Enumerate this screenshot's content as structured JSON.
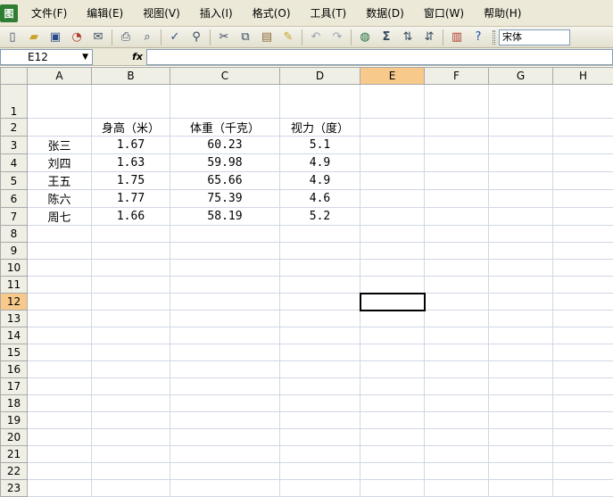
{
  "menu": {
    "app_icon": "图",
    "items": [
      "文件(F)",
      "编辑(E)",
      "视图(V)",
      "插入(I)",
      "格式(O)",
      "工具(T)",
      "数据(D)",
      "窗口(W)",
      "帮助(H)"
    ]
  },
  "toolbar": {
    "font_name": "宋体"
  },
  "formula": {
    "cell_ref": "E12",
    "fx": "fx",
    "content": ""
  },
  "columns": [
    "A",
    "B",
    "C",
    "D",
    "E",
    "F",
    "G",
    "H"
  ],
  "active_column": "E",
  "active_row": 12,
  "header_row": [
    "",
    "身高（米）",
    "体重（千克）",
    "视力（度）"
  ],
  "rows": [
    [
      "张三",
      "1.67",
      "60.23",
      "5.1"
    ],
    [
      "刘四",
      "1.63",
      "59.98",
      "4.9"
    ],
    [
      "王五",
      "1.75",
      "65.66",
      "4.9"
    ],
    [
      "陈六",
      "1.77",
      "75.39",
      "4.6"
    ],
    [
      "周七",
      "1.66",
      "58.19",
      "5.2"
    ]
  ],
  "row_numbers": [
    1,
    2,
    3,
    4,
    5,
    6,
    7,
    8,
    9,
    10,
    11,
    12,
    13,
    14,
    15,
    16,
    17,
    18,
    19,
    20,
    21,
    22,
    23
  ]
}
